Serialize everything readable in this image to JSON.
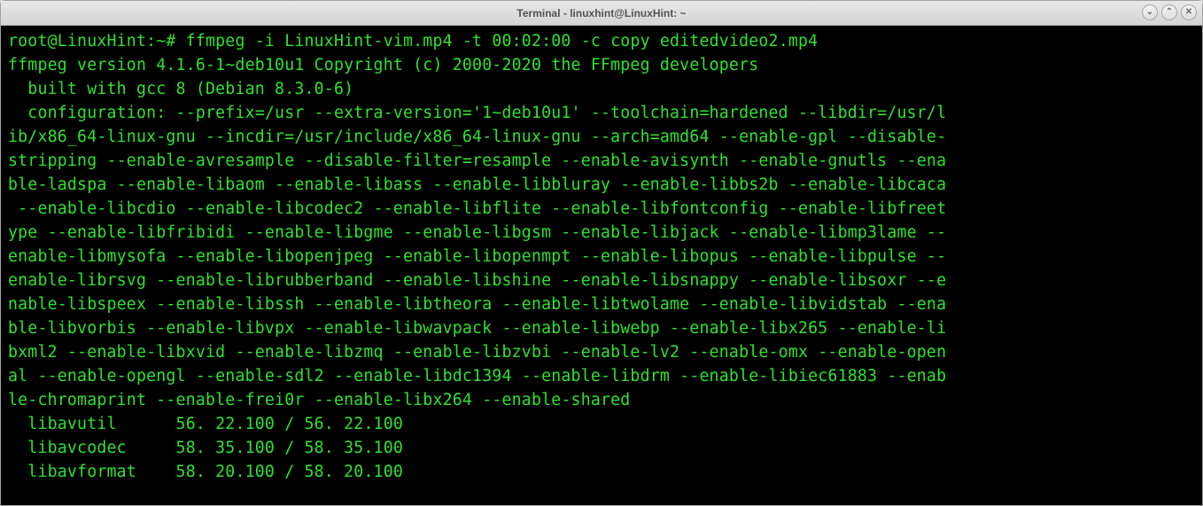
{
  "window": {
    "title": "Terminal - linuxhint@LinuxHint: ~"
  },
  "controls": {
    "minimize": "⌄",
    "maximize": "⌃",
    "close": "✕"
  },
  "terminal": {
    "prompt": "root@LinuxHint:~# ",
    "command": "ffmpeg -i LinuxHint-vim.mp4 -t 00:02:00 -c copy editedvideo2.mp4",
    "output_lines": [
      "ffmpeg version 4.1.6-1~deb10u1 Copyright (c) 2000-2020 the FFmpeg developers",
      "  built with gcc 8 (Debian 8.3.0-6)",
      "  configuration: --prefix=/usr --extra-version='1~deb10u1' --toolchain=hardened --libdir=/usr/l",
      "ib/x86_64-linux-gnu --incdir=/usr/include/x86_64-linux-gnu --arch=amd64 --enable-gpl --disable-",
      "stripping --enable-avresample --disable-filter=resample --enable-avisynth --enable-gnutls --ena",
      "ble-ladspa --enable-libaom --enable-libass --enable-libbluray --enable-libbs2b --enable-libcaca",
      " --enable-libcdio --enable-libcodec2 --enable-libflite --enable-libfontconfig --enable-libfreet",
      "ype --enable-libfribidi --enable-libgme --enable-libgsm --enable-libjack --enable-libmp3lame --",
      "enable-libmysofa --enable-libopenjpeg --enable-libopenmpt --enable-libopus --enable-libpulse --",
      "enable-librsvg --enable-librubberband --enable-libshine --enable-libsnappy --enable-libsoxr --e",
      "nable-libspeex --enable-libssh --enable-libtheora --enable-libtwolame --enable-libvidstab --ena",
      "ble-libvorbis --enable-libvpx --enable-libwavpack --enable-libwebp --enable-libx265 --enable-li",
      "bxml2 --enable-libxvid --enable-libzmq --enable-libzvbi --enable-lv2 --enable-omx --enable-open",
      "al --enable-opengl --enable-sdl2 --enable-libdc1394 --enable-libdrm --enable-libiec61883 --enab",
      "le-chromaprint --enable-frei0r --enable-libx264 --enable-shared",
      "  libavutil      56. 22.100 / 56. 22.100",
      "  libavcodec     58. 35.100 / 58. 35.100",
      "  libavformat    58. 20.100 / 58. 20.100"
    ]
  }
}
